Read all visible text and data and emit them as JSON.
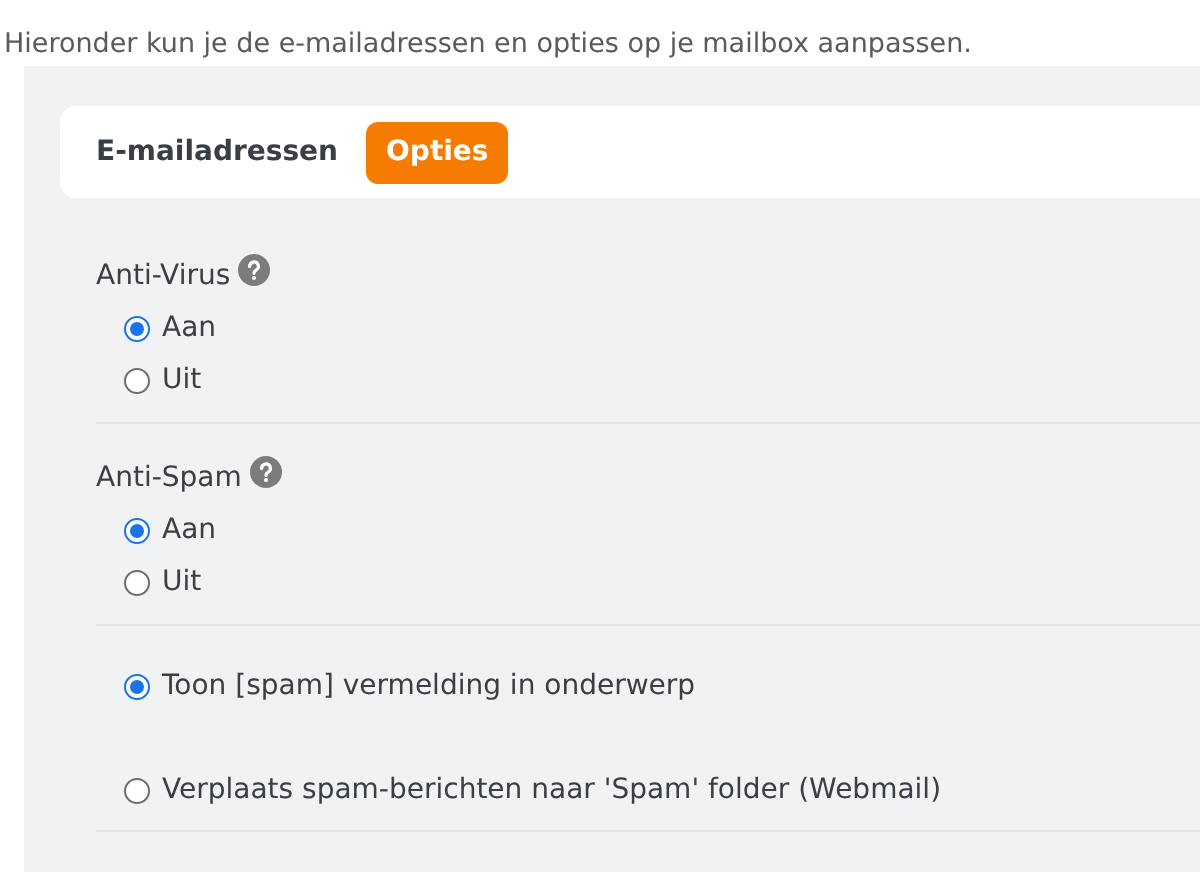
{
  "intro": "Hieronder kun je de e-mailadressen en opties op je mailbox aanpassen.",
  "tabs": [
    {
      "label": "E-mailadressen",
      "selected": false
    },
    {
      "label": "Opties",
      "selected": true
    }
  ],
  "sections": [
    {
      "title": "Anti-Virus",
      "options": [
        {
          "label": "Aan",
          "selected": true
        },
        {
          "label": "Uit",
          "selected": false
        }
      ]
    },
    {
      "title": "Anti-Spam",
      "options": [
        {
          "label": "Aan",
          "selected": true
        },
        {
          "label": "Uit",
          "selected": false
        }
      ]
    }
  ],
  "spam_handling": [
    {
      "label": "Toon [spam] vermelding in onderwerp",
      "selected": true
    },
    {
      "label": "Verplaats spam-berichten naar 'Spam' folder (Webmail)",
      "selected": false
    }
  ]
}
